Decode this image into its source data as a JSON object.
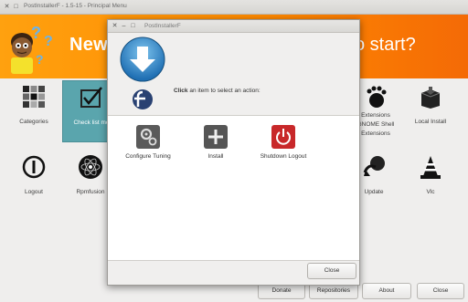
{
  "window": {
    "title": "PostInstallerF - 1.5-15 - Principal Menu"
  },
  "banner": {
    "text_left": "New",
    "text_right": "o start?"
  },
  "tiles": [
    {
      "label": "Categories"
    },
    {
      "label": "Check list mo"
    },
    {
      "label": "Extensions"
    },
    {
      "label": "GNOME Shell"
    },
    {
      "label": "Extensions"
    },
    {
      "label": "Local Install"
    },
    {
      "label": "Logout"
    },
    {
      "label": "Rpmfusion"
    },
    {
      "label": "Update"
    },
    {
      "label": "Vlc"
    }
  ],
  "bottom_buttons": {
    "donate": "Donate",
    "repositories": "Repositories",
    "about": "About",
    "close": "Close"
  },
  "dialog": {
    "title": "PostInstallerF",
    "prompt_bold": "Click",
    "prompt_rest": " an item to select an action:",
    "actions": [
      {
        "label": "Configure Tuning",
        "icon": "gears-icon"
      },
      {
        "label": "Install",
        "icon": "plus-icon"
      },
      {
        "label": "Shutdown Logout",
        "icon": "power-icon"
      }
    ],
    "close_label": "Close"
  },
  "colors": {
    "banner": "#ff8a00",
    "selected_tile": "#5aa5ad",
    "shutdown": "#c8282a"
  }
}
